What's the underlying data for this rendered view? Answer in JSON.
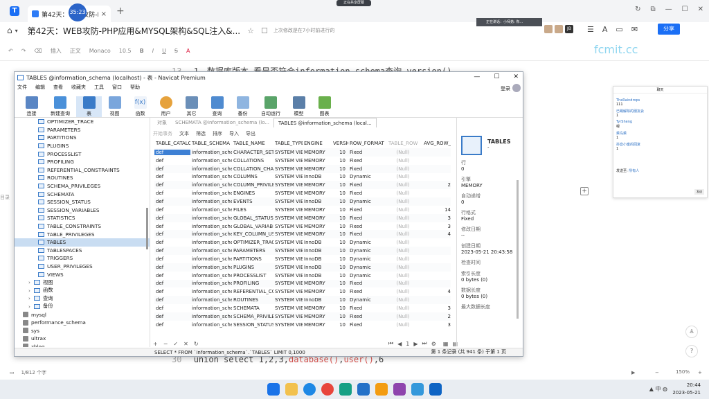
{
  "browser": {
    "tab_title": "第42天：WEB攻防-P...",
    "timer": "35:23",
    "share_pill": "正在共享屏幕",
    "doc_title": "第42天：WEB攻防-PHP应用&MYSQL架构&SQL注入&...",
    "save_status": "上次修改是在7小时前进行的",
    "voice_label": "正在讲话：小师弟: 你...",
    "share_button": "分享",
    "avatar_label": "JB"
  },
  "editor": {
    "font": "Monaco",
    "font_size": "10.5",
    "style": "正文",
    "insert": "插入",
    "watermark": "fcmit.cc",
    "line13_num": "13",
    "line13_text": "1、数据库版本-看是否符合information_schema查询-version()",
    "line30_num": "30",
    "line30_pre": "union select 1,2,3,",
    "line30_red": "database()",
    "line30_mid": ",",
    "line30_red2": "user()",
    "line30_post": ",6",
    "left_stub": "目录"
  },
  "navicat": {
    "window_title": "TABLES @information_schema (localhost) - 表 - Navicat Premium",
    "menu": [
      "文件",
      "编辑",
      "查看",
      "收藏夹",
      "工具",
      "窗口",
      "帮助"
    ],
    "login": "登录",
    "ribbon": [
      "连接",
      "新建查询",
      "表",
      "视图",
      "函数",
      "用户",
      "其它",
      "查询",
      "备份",
      "自动运行",
      "模型",
      "图表"
    ],
    "tree_tables": [
      "OPTIMIZER_TRACE",
      "PARAMETERS",
      "PARTITIONS",
      "PLUGINS",
      "PROCESSLIST",
      "PROFILING",
      "REFERENTIAL_CONSTRAINTS",
      "ROUTINES",
      "SCHEMA_PRIVILEGES",
      "SCHEMATA",
      "SESSION_STATUS",
      "SESSION_VARIABLES",
      "STATISTICS",
      "TABLE_CONSTRAINTS",
      "TABLE_PRIVILEGES",
      "TABLES",
      "TABLESPACES",
      "TRIGGERS",
      "USER_PRIVILEGES",
      "VIEWS"
    ],
    "tree_groups": [
      "视图",
      "函数",
      "查询",
      "备份"
    ],
    "tree_dbs": [
      "mysql",
      "performance_schema",
      "sys",
      "ultrax",
      "zblog"
    ],
    "tabs": [
      "对象",
      "SCHEMATA @information_schema (lo...",
      "TABLES @information_schema (local..."
    ],
    "subtool": [
      "开始事务",
      "文本",
      "筛选",
      "排序",
      "导入",
      "导出"
    ],
    "columns": [
      "TABLE_CATALOG",
      "TABLE_SCHEMA",
      "TABLE_NAME",
      "TABLE_TYPE",
      "ENGINE",
      "VERSION",
      "ROW_FORMAT",
      "TABLE_ROWS",
      "AVG_ROW_"
    ],
    "rows": [
      [
        "def",
        "information_sche",
        "CHARACTER_SET",
        "SYSTEM VIEW",
        "MEMORY",
        "10",
        "Fixed",
        "(Null)",
        ""
      ],
      [
        "def",
        "information_sche",
        "COLLATIONS",
        "SYSTEM VIEW",
        "MEMORY",
        "10",
        "Fixed",
        "(Null)",
        ""
      ],
      [
        "def",
        "information_sche",
        "COLLATION_CHA",
        "SYSTEM VIEW",
        "MEMORY",
        "10",
        "Fixed",
        "(Null)",
        ""
      ],
      [
        "def",
        "information_sche",
        "COLUMNS",
        "SYSTEM VIEW",
        "InnoDB",
        "10",
        "Dynamic",
        "(Null)",
        ""
      ],
      [
        "def",
        "information_sche",
        "COLUMN_PRIVILE",
        "SYSTEM VIEW",
        "MEMORY",
        "10",
        "Fixed",
        "(Null)",
        "2"
      ],
      [
        "def",
        "information_sche",
        "ENGINES",
        "SYSTEM VIEW",
        "MEMORY",
        "10",
        "Fixed",
        "(Null)",
        ""
      ],
      [
        "def",
        "information_sche",
        "EVENTS",
        "SYSTEM VIEW",
        "InnoDB",
        "10",
        "Dynamic",
        "(Null)",
        ""
      ],
      [
        "def",
        "information_sche",
        "FILES",
        "SYSTEM VIEW",
        "MEMORY",
        "10",
        "Fixed",
        "(Null)",
        "14"
      ],
      [
        "def",
        "information_sche",
        "GLOBAL_STATUS",
        "SYSTEM VIEW",
        "MEMORY",
        "10",
        "Fixed",
        "(Null)",
        "3"
      ],
      [
        "def",
        "information_sche",
        "GLOBAL_VARIABI",
        "SYSTEM VIEW",
        "MEMORY",
        "10",
        "Fixed",
        "(Null)",
        "3"
      ],
      [
        "def",
        "information_sche",
        "KEY_COLUMN_US",
        "SYSTEM VIEW",
        "MEMORY",
        "10",
        "Fixed",
        "(Null)",
        "4"
      ],
      [
        "def",
        "information_sche",
        "OPTIMIZER_TRAC",
        "SYSTEM VIEW",
        "InnoDB",
        "10",
        "Dynamic",
        "(Null)",
        ""
      ],
      [
        "def",
        "information_sche",
        "PARAMETERS",
        "SYSTEM VIEW",
        "InnoDB",
        "10",
        "Dynamic",
        "(Null)",
        ""
      ],
      [
        "def",
        "information_sche",
        "PARTITIONS",
        "SYSTEM VIEW",
        "InnoDB",
        "10",
        "Dynamic",
        "(Null)",
        ""
      ],
      [
        "def",
        "information_sche",
        "PLUGINS",
        "SYSTEM VIEW",
        "InnoDB",
        "10",
        "Dynamic",
        "(Null)",
        ""
      ],
      [
        "def",
        "information_sche",
        "PROCESSLIST",
        "SYSTEM VIEW",
        "InnoDB",
        "10",
        "Dynamic",
        "(Null)",
        ""
      ],
      [
        "def",
        "information_sche",
        "PROFILING",
        "SYSTEM VIEW",
        "MEMORY",
        "10",
        "Fixed",
        "(Null)",
        ""
      ],
      [
        "def",
        "information_sche",
        "REFERENTIAL_CC",
        "SYSTEM VIEW",
        "MEMORY",
        "10",
        "Fixed",
        "(Null)",
        "4"
      ],
      [
        "def",
        "information_sche",
        "ROUTINES",
        "SYSTEM VIEW",
        "InnoDB",
        "10",
        "Dynamic",
        "(Null)",
        ""
      ],
      [
        "def",
        "information_sche",
        "SCHEMATA",
        "SYSTEM VIEW",
        "MEMORY",
        "10",
        "Fixed",
        "(Null)",
        "3"
      ],
      [
        "def",
        "information_sche",
        "SCHEMA_PRIVILE",
        "SYSTEM VIEW",
        "MEMORY",
        "10",
        "Fixed",
        "(Null)",
        "2"
      ],
      [
        "def",
        "information_sche",
        "SESSION_STATUS",
        "SYSTEM VIEW",
        "MEMORY",
        "10",
        "Fixed",
        "(Null)",
        "3"
      ]
    ],
    "sql": "SELECT * FROM `information_schema`.`TABLES` LIMIT 0,1000",
    "record_status": "第 1 条记录 (共 941 条) 于第 1 页",
    "page": "1",
    "info": {
      "name": "TABLES",
      "sub": "-",
      "fields": [
        {
          "label": "行",
          "value": "0"
        },
        {
          "label": "引擎",
          "value": "MEMORY"
        },
        {
          "label": "自动递增",
          "value": "0"
        },
        {
          "label": "行格式",
          "value": "Fixed"
        },
        {
          "label": "修改日期",
          "value": "--"
        },
        {
          "label": "创建日期",
          "value": "2023-05-21 20:43:58"
        },
        {
          "label": "检查时间",
          "value": ""
        },
        {
          "label": "索引长度",
          "value": "0 bytes (0)"
        },
        {
          "label": "数据长度",
          "value": "0 bytes (0)"
        },
        {
          "label": "最大数据长度",
          "value": ""
        }
      ]
    }
  },
  "chat": {
    "title": "聊天",
    "messages": [
      {
        "name": "TheRaindrops",
        "text": "111"
      },
      {
        "name": "已踢解除的朋友会",
        "text": "1"
      },
      {
        "name": "TyrSheng",
        "text": "嗯"
      },
      {
        "name": "菜鸟菜",
        "text": "1"
      },
      {
        "name": "抖音小蜜的回复",
        "text": "1"
      }
    ],
    "send_to_label": "发送至:",
    "send_to_value": "所有人",
    "send_button": "发送"
  },
  "status": {
    "word_count": "1/812 个字",
    "zoom": "150%"
  },
  "taskbar": {
    "time": "20:44",
    "date": "2023-05-21"
  }
}
